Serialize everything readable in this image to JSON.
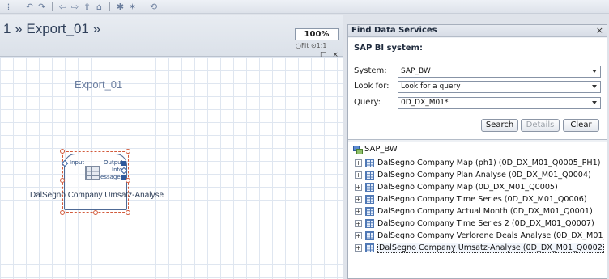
{
  "editor": {
    "breadcrumb": "1 » Export_01 »",
    "zoom_value": "100%",
    "zoom_fit": "○Fit  ⊙1:1",
    "window_controls": "□ ×",
    "canvas_title": "Export_01",
    "node": {
      "port_input": "Input",
      "port_output": "Output",
      "port_info": "Info",
      "port_messages": "Messages",
      "name": "DalSegno Company Umsatz-Analyse"
    }
  },
  "panel": {
    "title": "Find Data Services",
    "close": "×",
    "heading": "SAP BI system:",
    "system_label": "System:",
    "system_value": "SAP_BW",
    "lookfor_label": "Look for:",
    "lookfor_value": "Look for a query",
    "query_label": "Query:",
    "query_value": "0D_DX_M01*",
    "search_btn": "Search",
    "details_btn": "Details",
    "clear_btn": "Clear",
    "tree_root": "SAP_BW",
    "tree_items": [
      "DalSegno Company Map (ph1) (0D_DX_M01_Q0005_PH1)",
      "DalSegno Company Plan Analyse (0D_DX_M01_Q0004)",
      "DalSegno Company Map (0D_DX_M01_Q0005)",
      "DalSegno Company Time Series (0D_DX_M01_Q0006)",
      "DalSegno Company Actual Month (0D_DX_M01_Q0001)",
      "DalSegno Company Time Series 2 (0D_DX_M01_Q0007)",
      "DalSegno Company Verlorene Deals Analyse (0D_DX_M01_Q",
      "DalSegno Company Umsatz-Analyse (0D_DX_M01_Q0002)"
    ],
    "selected_index": 7
  },
  "toolbar": {
    "icons": [
      "save-icon",
      "undo-icon",
      "redo-icon",
      "back-icon",
      "forward-icon",
      "up-icon",
      "home-icon",
      "pin-icon",
      "run-icon",
      "help-icon"
    ]
  }
}
